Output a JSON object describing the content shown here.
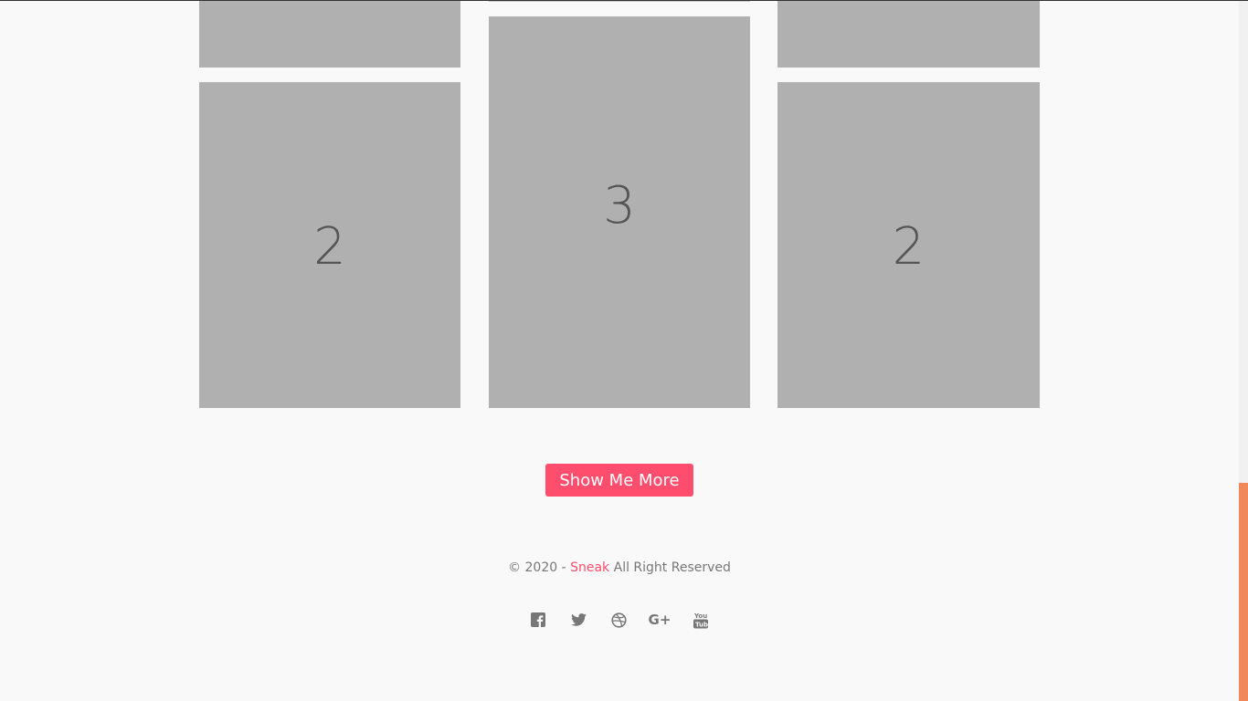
{
  "grid": {
    "tiles": [
      {
        "label": ""
      },
      {
        "label": "2"
      },
      {
        "label": ""
      },
      {
        "label": "3"
      },
      {
        "label": ""
      },
      {
        "label": "2"
      }
    ]
  },
  "more_button": {
    "label": "Show Me More"
  },
  "footer": {
    "copyright_prefix": "© 2020 - ",
    "brand": "Sneak",
    "copyright_suffix": " All Right Reserved"
  },
  "social": [
    {
      "icon": "facebook-icon"
    },
    {
      "icon": "twitter-icon"
    },
    {
      "icon": "dribbble-icon"
    },
    {
      "icon": "google-plus-icon",
      "text": "G+"
    },
    {
      "icon": "youtube-icon"
    }
  ],
  "colors": {
    "accent": "#ff4d6d",
    "tile": "#b0b0b0",
    "scroll_thumb": "#f0885a",
    "background": "#f9f9f9"
  }
}
